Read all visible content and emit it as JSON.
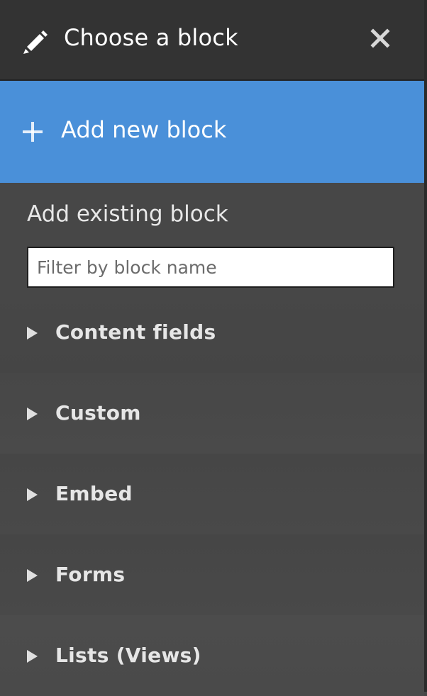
{
  "header": {
    "title": "Choose a block",
    "edit_icon": "pencil-icon",
    "close_icon": "close-icon"
  },
  "add_new": {
    "label": "Add new block",
    "icon": "plus-icon",
    "color": "#4a90d9"
  },
  "existing": {
    "heading": "Add existing block",
    "filter_placeholder": "Filter by block name",
    "filter_value": ""
  },
  "categories": [
    {
      "label": "Content fields",
      "icon": "triangle-right-icon"
    },
    {
      "label": "Custom",
      "icon": "triangle-right-icon"
    },
    {
      "label": "Embed",
      "icon": "triangle-right-icon"
    },
    {
      "label": "Forms",
      "icon": "triangle-right-icon"
    },
    {
      "label": "Lists (Views)",
      "icon": "triangle-right-icon"
    }
  ]
}
